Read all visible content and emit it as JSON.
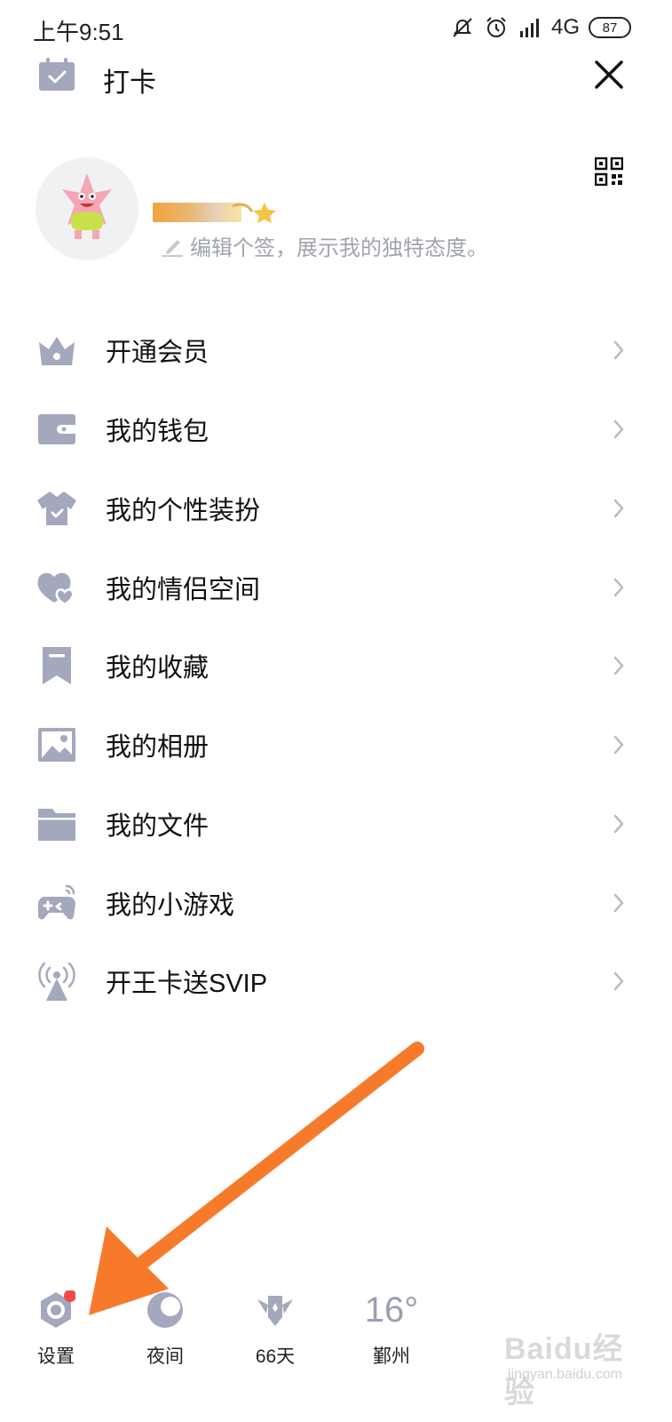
{
  "status_bar": {
    "time": "上午9:51",
    "network": "4G",
    "battery": "87",
    "icons": [
      "mute-icon",
      "alarm-icon",
      "signal-icon"
    ]
  },
  "topbar": {
    "checkin_label": "打卡",
    "icons": [
      "calendar-check-icon",
      "close-icon"
    ]
  },
  "profile": {
    "signature_placeholder": "编辑个签，展示我的独特态度。",
    "icons": [
      "avatar-image",
      "qr-code-icon",
      "pen-icon"
    ]
  },
  "menu": {
    "items": [
      {
        "label": "开通会员",
        "icon": "crown-icon"
      },
      {
        "label": "我的钱包",
        "icon": "wallet-icon"
      },
      {
        "label": "我的个性装扮",
        "icon": "tshirt-icon"
      },
      {
        "label": "我的情侣空间",
        "icon": "hearts-icon"
      },
      {
        "label": "我的收藏",
        "icon": "bookmark-icon"
      },
      {
        "label": "我的相册",
        "icon": "photo-icon"
      },
      {
        "label": "我的文件",
        "icon": "folder-icon"
      },
      {
        "label": "我的小游戏",
        "icon": "gamepad-icon"
      },
      {
        "label": "开王卡送SVIP",
        "icon": "signal-tower-icon"
      }
    ]
  },
  "bottom_bar": {
    "settings_label": "设置",
    "night_label": "夜间",
    "days_label": "66天",
    "temperature": "16°",
    "city": "鄞州",
    "icons": [
      "settings-icon",
      "moon-icon",
      "winged-badge-icon"
    ]
  },
  "watermark": {
    "brand": "Baidu经验",
    "site": "jingyan.baidu.com"
  },
  "colors": {
    "icon_gray": "#a3a8bd",
    "chevron": "#b8bcc6",
    "annotation_arrow": "#f77a2b",
    "badge_red": "#f04a4a"
  }
}
